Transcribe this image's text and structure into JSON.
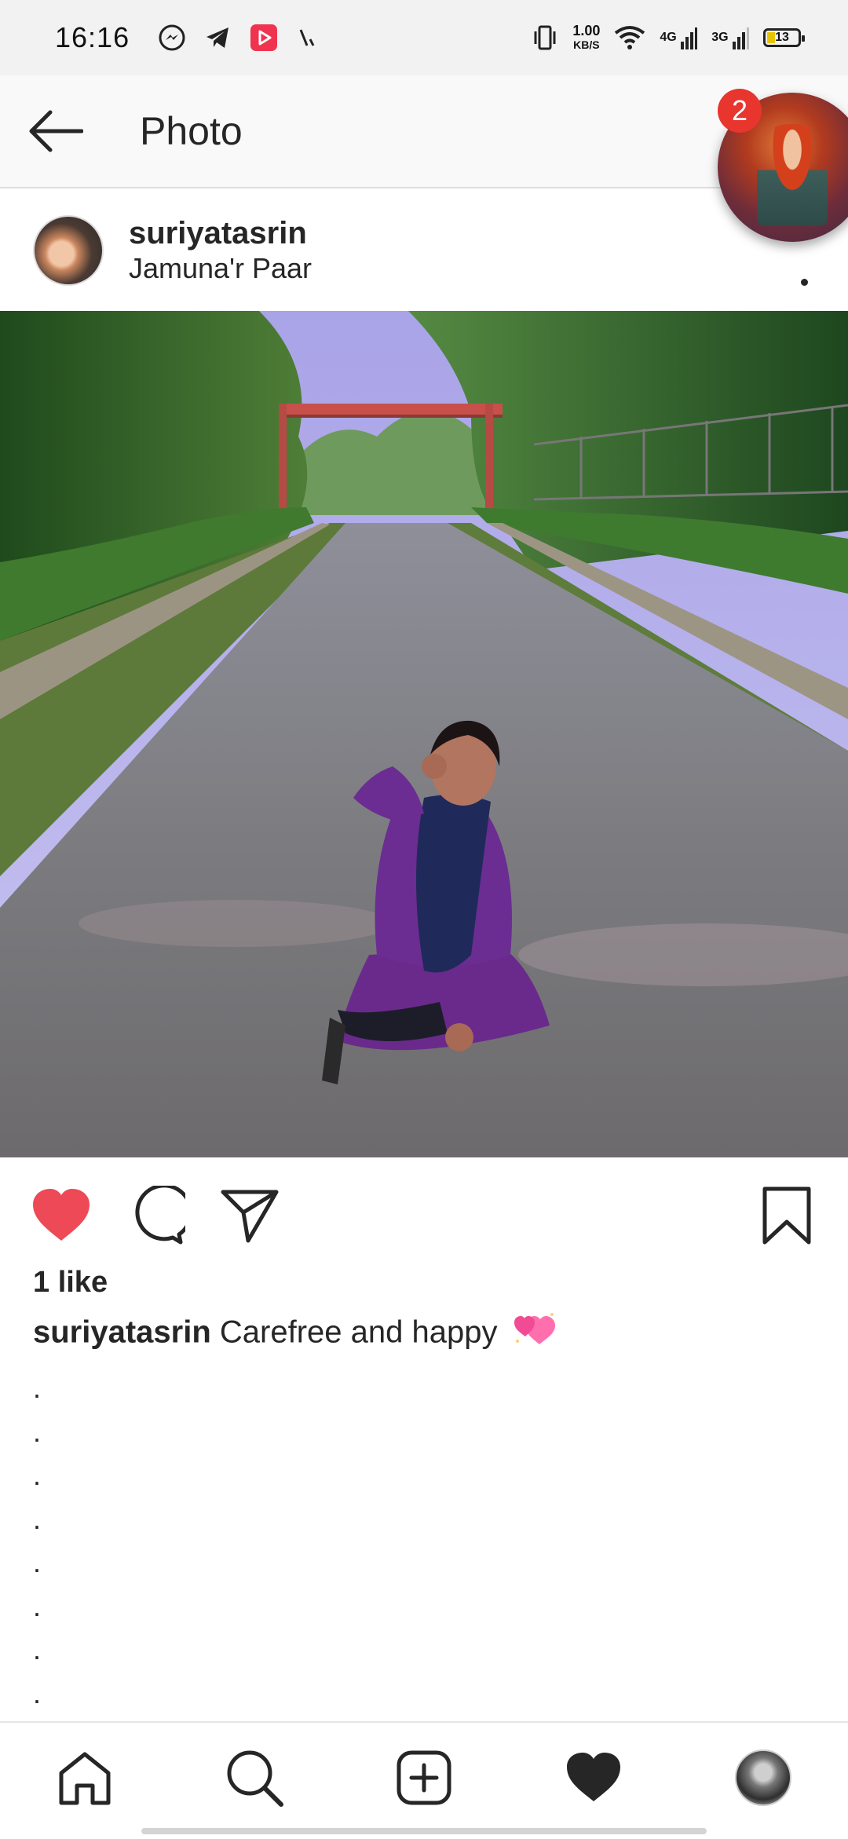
{
  "status_bar": {
    "time": "16:16",
    "net_speed": "1.00",
    "net_speed_unit": "KB/S",
    "network_1": "4G",
    "network_2": "3G",
    "battery": "13",
    "icons": [
      "messenger-icon",
      "telegram-icon",
      "youtube-icon",
      "signal-slash-icon",
      "vibrate-icon",
      "wifi-icon"
    ]
  },
  "app_bar": {
    "title": "Photo",
    "back_icon": "arrow-left-icon"
  },
  "chat_head": {
    "badge_count": "2"
  },
  "post": {
    "username": "suriyatasrin",
    "location": "Jamuna'r Paar",
    "likes": "1 like",
    "caption_user": "suriyatasrin",
    "caption_text": "Carefree and happy",
    "caption_emoji": "heart-sparkles-emoji",
    "caption_dots": [
      ".",
      ".",
      ".",
      ".",
      ".",
      ".",
      ".",
      "."
    ]
  },
  "actions": {
    "like": "heart-filled-icon",
    "comment": "comment-icon",
    "share": "send-icon",
    "save": "bookmark-icon"
  },
  "bottom_nav": [
    "home-icon",
    "search-icon",
    "add-post-icon",
    "activity-heart-icon",
    "profile-avatar"
  ],
  "colors": {
    "like_red": "#ed4956",
    "badge_red": "#e8352e",
    "text": "#262626"
  }
}
